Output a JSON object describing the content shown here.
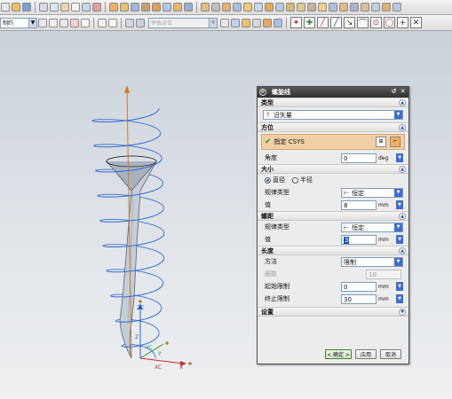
{
  "toolbar": {
    "layer_combo": "制约",
    "selection_filter_placeholder": "评估点位",
    "snap_icons": [
      "endpoint-snap",
      "midpoint-snap",
      "control-point-snap",
      "intersection-snap",
      "center-snap",
      "quadrant-snap",
      "point-on-curve-snap",
      "existing-point-snap"
    ]
  },
  "viewport": {
    "axis_labels": {
      "xc": "XC",
      "yc": "YC",
      "zc": "ZC",
      "x": "X",
      "y": "Y",
      "z": "Z"
    },
    "colors": {
      "helix": "#2f6ad8",
      "screw": "#c5cdd6",
      "axis": "#d47a1e",
      "background_top": "#c6ced7",
      "background_bottom": "#eef0f2"
    }
  },
  "dialog": {
    "title": "螺旋线",
    "title_buttons": [
      "reset",
      "close"
    ],
    "sections": {
      "type": {
        "header": "类型",
        "value": "沿矢量"
      },
      "orientation": {
        "header": "方位",
        "csys_label": "指定 CSYS",
        "angle_label": "角度",
        "angle_value": "0",
        "angle_unit": "deg"
      },
      "size": {
        "header": "大小",
        "radio_diameter": "直径",
        "radio_radius": "半径",
        "law_type_label": "规律类型",
        "law_type_value": "恒定",
        "value_label": "值",
        "value": "8",
        "unit": "mm"
      },
      "pitch": {
        "header": "螺距",
        "law_type_label": "规律类型",
        "law_type_value": "恒定",
        "value_label": "值",
        "value": "3",
        "unit": "mm"
      },
      "length": {
        "header": "长度",
        "method_label": "方法",
        "method_value": "限制",
        "turns_label": "圈数",
        "turns_value": "10",
        "start_label": "起始限制",
        "start_value": "0",
        "end_label": "终止限制",
        "end_value": "30",
        "unit": "mm"
      },
      "settings": {
        "header": "设置"
      }
    },
    "buttons": {
      "ok": "< 确定 >",
      "apply": "应用",
      "cancel": "取消"
    }
  }
}
